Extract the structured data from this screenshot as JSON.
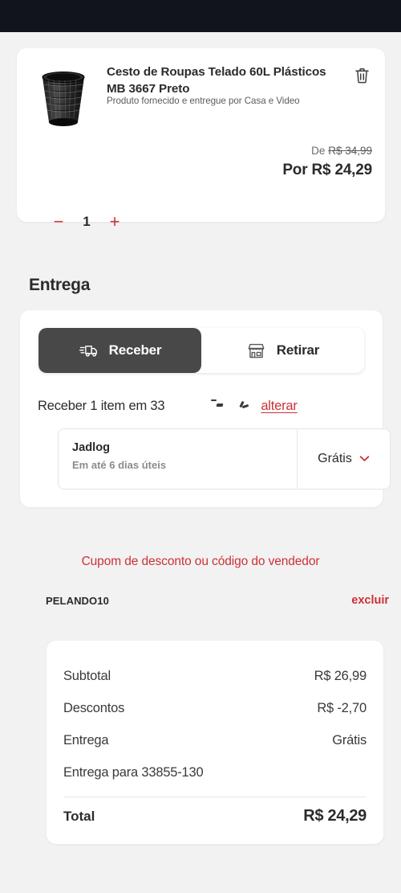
{
  "colors": {
    "brand_red": "#cb3235",
    "page_bg": "#f2f2f2",
    "topbar": "#12141c",
    "toggle_active_bg": "#484848",
    "text_dark": "#2b2b2b",
    "text_muted": "#8c8c8c"
  },
  "topbar": {
    "label": ""
  },
  "product": {
    "title": "Cesto de Roupas Telado 60L Plásticos MB 3667 Preto",
    "seller": "Produto fornecido e entregue por Casa e Video",
    "image_alt": "cesto-de-roupas-telado-preto",
    "delete_icon": "trash-icon",
    "price_prefix": "De",
    "price_old": "R$ 34,99",
    "price_new": "Por R$ 24,29",
    "quantity": "1",
    "decrease_label": "−",
    "increase_label": "+"
  },
  "delivery": {
    "section_title": "Entrega",
    "tabs": [
      {
        "label": "Receber",
        "icon": "delivery-truck-icon",
        "active": true
      },
      {
        "label": "Retirar",
        "icon": "store-front-icon",
        "active": false
      }
    ],
    "summary_text": "Receber 1 item em 33",
    "change_label": "alterar",
    "option": {
      "carrier": "Jadlog",
      "eta": "Em até 6 dias úteis",
      "price": "Grátis",
      "expand_icon": "chevron-down-icon"
    }
  },
  "coupon": {
    "link_label": "Cupom de desconto ou código do vendedor",
    "code": "PELANDO10",
    "remove_label": "excluir"
  },
  "summary": {
    "rows": [
      {
        "label": "Subtotal",
        "value": "R$ 26,99"
      },
      {
        "label": "Descontos",
        "value": "R$ -2,70"
      },
      {
        "label": "Entrega",
        "value": "Grátis"
      },
      {
        "label": "Entrega para 33855-130",
        "value": ""
      }
    ],
    "total_label": "Total",
    "total_value": "R$ 24,29"
  }
}
